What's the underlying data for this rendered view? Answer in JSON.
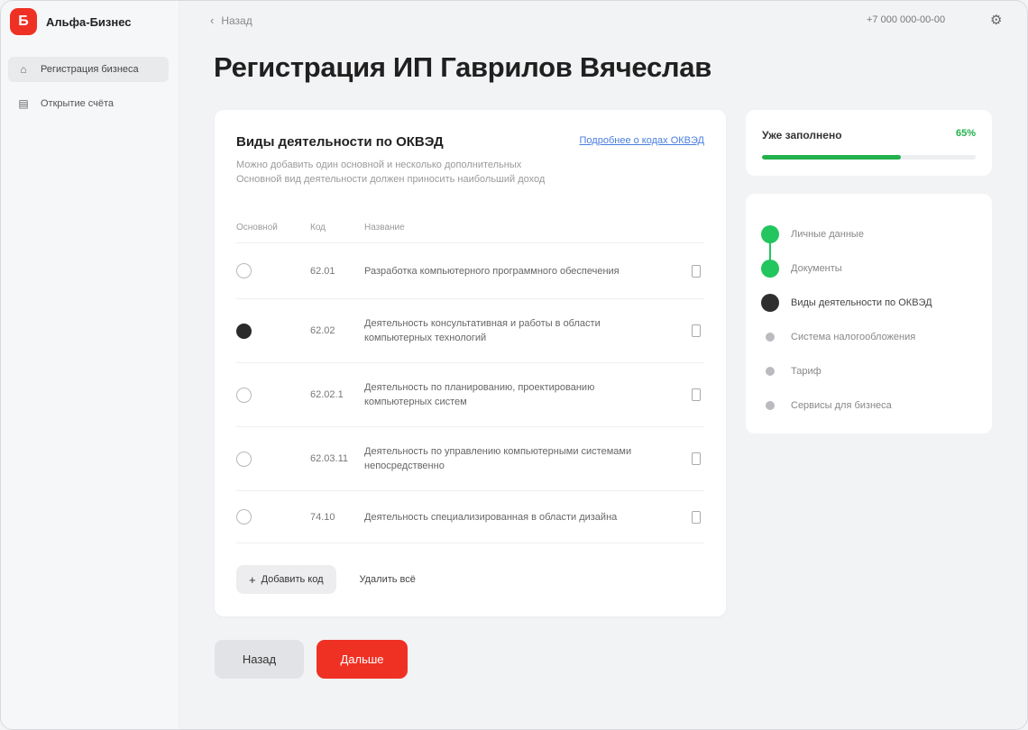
{
  "brand": {
    "logo_letter": "Б",
    "name": "Альфа-Бизнес"
  },
  "sidebar": {
    "items": [
      {
        "label": "Регистрация бизнеса",
        "icon": "home-icon",
        "active": true
      },
      {
        "label": "Открытие счёта",
        "icon": "document-icon",
        "active": false
      }
    ]
  },
  "topbar": {
    "back_label": "Назад",
    "phone": "+7 000 000-00-00",
    "settings_icon": "gear-icon"
  },
  "page": {
    "title": "Регистрация ИП Гаврилов Вячеслав"
  },
  "okved": {
    "title": "Виды деятельности по ОКВЭД",
    "link": "Подробнее о кодах ОКВЭД",
    "description_lines": [
      "Можно добавить один основной и несколько дополнительных",
      "Основной вид деятельности должен приносить наибольший доход"
    ],
    "columns": {
      "main": "Основной",
      "code": "Код",
      "name": "Название"
    },
    "rows": [
      {
        "code": "62.01",
        "name": "Разработка компьютерного программного обеспечения",
        "main": false
      },
      {
        "code": "62.02",
        "name": "Деятельность консультативная и работы в области компьютерных технологий",
        "main": true
      },
      {
        "code": "62.02.1",
        "name": "Деятельность по планированию, проектированию компьютерных систем",
        "main": false
      },
      {
        "code": "62.03.11",
        "name": "Деятельность по управлению компьютерными системами непосредственно",
        "main": false
      },
      {
        "code": "74.10",
        "name": "Деятельность специализированная в области дизайна",
        "main": false
      }
    ],
    "add_label": "Добавить код",
    "delete_label": "Удалить всё"
  },
  "footer_buttons": {
    "back": "Назад",
    "next": "Дальше"
  },
  "progress": {
    "label": "Уже заполнено",
    "percent_label": "65%",
    "fraction": 0.65
  },
  "steps": [
    {
      "label": "Личные данные",
      "state": "done"
    },
    {
      "label": "Документы",
      "state": "done"
    },
    {
      "label": "Виды деятельности по ОКВЭД",
      "state": "current"
    },
    {
      "label": "Система налогообложения",
      "state": "todo"
    },
    {
      "label": "Тариф",
      "state": "todo"
    },
    {
      "label": "Сервисы для бизнеса",
      "state": "todo"
    }
  ],
  "colors": {
    "brand_red": "#ef3124",
    "success_green": "#22b14c",
    "link_blue": "#4a7dde"
  }
}
